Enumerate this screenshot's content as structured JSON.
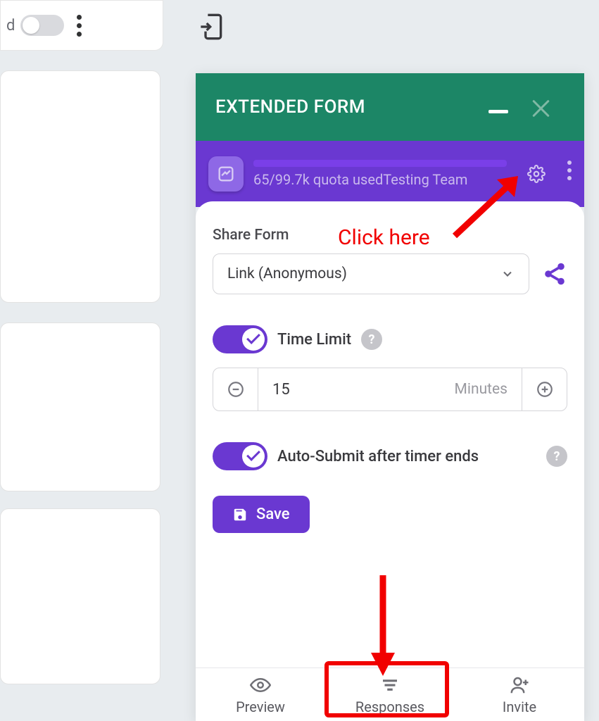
{
  "left": {
    "dchar": "d"
  },
  "panel": {
    "title": "EXTENDED FORM",
    "quota": "65/99.7k quota usedTesting Team"
  },
  "share": {
    "label": "Share Form",
    "selected": "Link (Anonymous)"
  },
  "timeLimit": {
    "label": "Time Limit",
    "value": "15",
    "unit": "Minutes"
  },
  "autoSubmit": {
    "label": "Auto-Submit after timer ends"
  },
  "save": {
    "label": "Save"
  },
  "tabs": {
    "preview": "Preview",
    "responses": "Responses",
    "invite": "Invite"
  },
  "annotation": {
    "clickHere": "Click here"
  }
}
